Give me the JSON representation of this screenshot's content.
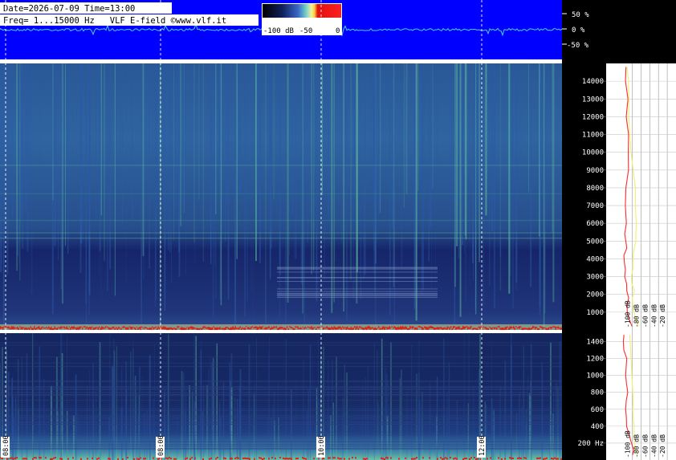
{
  "header": {
    "line1": "Date=2026-07-09 Time=13:00",
    "line2": "Freq= 1...15000 Hz   VLF E-field ©www.vlf.it"
  },
  "colorbar": {
    "colors": [
      "#000000",
      "#10205a",
      "#3a66c8",
      "#6fd0c8",
      "#f0f0a0",
      "#f8d040",
      "#e01010",
      "#ff2020"
    ],
    "labels": [
      "-100 dB",
      "-50",
      "0"
    ]
  },
  "waveform": {
    "bg_color": "#0000ff",
    "trace_color": "#48d0e0",
    "scale_labels": [
      "50 %",
      "0 %",
      "-50 %"
    ]
  },
  "spectrogram_colors": {
    "low": "#142a6a",
    "mid": "#2c5aa8",
    "high": "#5fc0a0",
    "hot": "#e0e080",
    "red": "#e02010"
  },
  "chart_data": [
    {
      "type": "heatmap",
      "name": "upper",
      "ylim": [
        0,
        15000
      ],
      "yticks": [
        1000,
        2000,
        3000,
        4000,
        5000,
        6000,
        7000,
        8000,
        9000,
        10000,
        11000,
        12000,
        13000,
        14000
      ],
      "ytick_labels": [
        "1000",
        "2000",
        "3000",
        "4000",
        "5000",
        "6000",
        "7000",
        "8000",
        "9000",
        "10000",
        "11000",
        "12000",
        "13000",
        "14000"
      ]
    },
    {
      "type": "heatmap",
      "name": "lower",
      "ylim": [
        0,
        1500
      ],
      "yticks": [
        200,
        400,
        600,
        800,
        1000,
        1200,
        1400
      ],
      "ytick_labels": [
        "200 Hz",
        "400",
        "600",
        "800",
        "1000",
        "1200",
        "1400"
      ]
    },
    {
      "type": "line",
      "name": "time-axis",
      "xlim": [
        6.0,
        13.0
      ],
      "time_marks": [
        8,
        10,
        12
      ],
      "time_labels": [
        "08:00",
        "08:00",
        "10:00",
        "12:00"
      ],
      "label_times": [
        6,
        8,
        10,
        12
      ],
      "grid_times": [
        6,
        8,
        10,
        12
      ]
    },
    {
      "type": "line",
      "name": "spectrum-upper",
      "xlim": [
        -160,
        0
      ],
      "xticks": [
        -100,
        -80,
        -60,
        -40,
        -20
      ],
      "xtick_labels": [
        "-100 dB",
        "-80 dB",
        "-60 dB",
        "-40 dB",
        "-20 dB"
      ],
      "series": [
        {
          "color": "#ff2a2a",
          "y": [
            200,
            600,
            1000,
            1400,
            1800,
            2200,
            2600,
            3000,
            3400,
            3800,
            4200,
            4600,
            5000,
            5400,
            6000,
            7000,
            8000,
            9000,
            10000,
            11000,
            12000,
            13000,
            14000,
            14800
          ],
          "x": [
            -100,
            -104,
            -108,
            -112,
            -112,
            -114,
            -116,
            -118,
            -118,
            -117,
            -116,
            -115,
            -115,
            -114,
            -114,
            -113,
            -112,
            -112,
            -112,
            -112,
            -111,
            -112,
            -113,
            -116
          ]
        },
        {
          "color": "#f0f070",
          "y": [
            200,
            600,
            1000,
            1400,
            1800,
            2200,
            2600,
            3000,
            3400,
            3800,
            4200,
            4600,
            5000,
            5400,
            6000,
            7000,
            8000,
            9000,
            10000,
            11000,
            12000,
            13000,
            14000,
            14800
          ],
          "x": [
            -85,
            -92,
            -96,
            -99,
            -100,
            -95,
            -101,
            -102,
            -99,
            -99,
            -98,
            -96,
            -92,
            -92,
            -91,
            -93,
            -93,
            -98,
            -103,
            -106,
            -108,
            -108,
            -109,
            -112
          ]
        }
      ]
    },
    {
      "type": "line",
      "name": "spectrum-lower",
      "xlim": [
        -160,
        0
      ],
      "xticks": [
        -100,
        -80,
        -60,
        -40,
        -20
      ],
      "xtick_labels": [
        "-100 dB",
        "-80 dB",
        "-60 dB",
        "-40 dB",
        "-20 dB"
      ],
      "series": [
        {
          "color": "#ff2a2a",
          "y": [
            60,
            120,
            200,
            300,
            400,
            500,
            600,
            700,
            800,
            900,
            1000,
            1100,
            1200,
            1300,
            1400,
            1480
          ],
          "x": [
            -96,
            -100,
            -104,
            -108,
            -110,
            -112,
            -113,
            -114,
            -113,
            -114,
            -115,
            -116,
            -114,
            -116,
            -117,
            -118
          ]
        },
        {
          "color": "#f0f070",
          "y": [
            60,
            120,
            200,
            300,
            400,
            500,
            600,
            700,
            800,
            900,
            1000,
            1100,
            1200,
            1300,
            1400,
            1480
          ],
          "x": [
            -88,
            -92,
            -95,
            -96,
            -96,
            -98,
            -99,
            -98,
            -99,
            -100,
            -101,
            -102,
            -103,
            -104,
            -105,
            -106
          ]
        }
      ]
    }
  ]
}
